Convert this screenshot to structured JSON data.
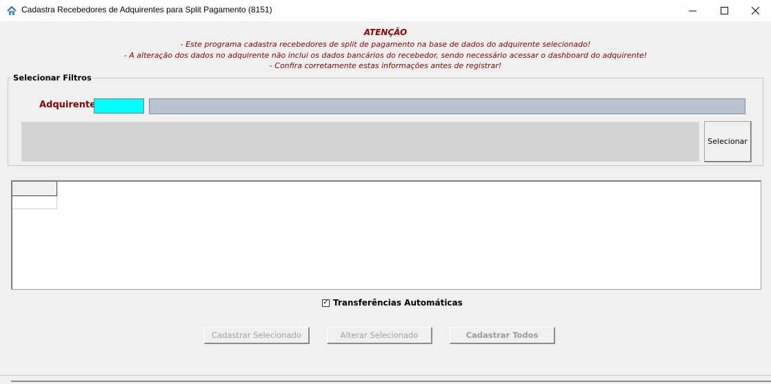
{
  "window": {
    "title": "Cadastra Recebedores de Adquirentes para Split Pagamento (8151)",
    "icon": "app-house-icon",
    "controls": [
      "minimize-icon",
      "maximize-icon",
      "close-icon"
    ]
  },
  "attention": {
    "title": "ATENÇÃO",
    "lines": [
      "- Este programa cadastra recebedores de split de pagamento na base de dados do adquirente selecionado!",
      "- A alteração dos dados no adquirente não inclui os dados bancários do recebedor, sendo necessário acessar o dashboard do adquirente!",
      "- Confira corretamente estas informações antes de registrar!"
    ],
    "color": "#8b0000"
  },
  "filters": {
    "legend": "Selecionar Filtros",
    "adquirente_label": "Adquirente",
    "adquirente_code": "",
    "adquirente_name": "",
    "select_button": "Selecionar",
    "code_bg": "#00ffff",
    "name_bg": "#b8c3d1"
  },
  "grid": {
    "header": "",
    "cell": ""
  },
  "options": {
    "auto_transfer_label": "Transferências Automáticas",
    "auto_transfer_checked": true,
    "check_mark": "✓"
  },
  "actions": {
    "register_selected": "Cadastrar Selecionado",
    "change_selected": "Alterar Selecionado",
    "register_all": "Cadastrar Todos"
  }
}
